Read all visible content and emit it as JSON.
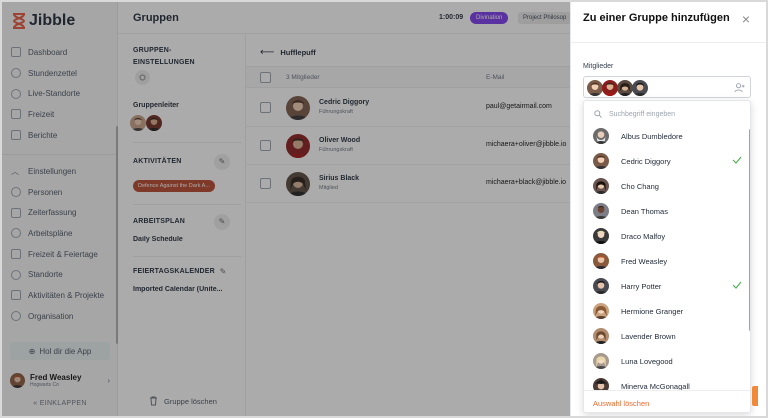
{
  "app": {
    "name": "Jibble"
  },
  "sidebar": {
    "items": [
      {
        "label": "Dashboard",
        "icon": "dashboard-icon"
      },
      {
        "label": "Stundenzettel",
        "icon": "clock-icon"
      },
      {
        "label": "Live-Standorte",
        "icon": "location-icon"
      },
      {
        "label": "Freizeit",
        "icon": "calendar-icon"
      },
      {
        "label": "Berichte",
        "icon": "report-icon"
      }
    ],
    "settings_items": [
      {
        "label": "Einstellungen",
        "icon": "chevron-up-icon"
      },
      {
        "label": "Personen",
        "icon": "people-icon"
      },
      {
        "label": "Zeiterfassung",
        "icon": "timer-icon"
      },
      {
        "label": "Arbeitspläne",
        "icon": "schedule-icon"
      },
      {
        "label": "Freizeit & Feiertage",
        "icon": "holiday-icon"
      },
      {
        "label": "Standorte",
        "icon": "location-icon"
      },
      {
        "label": "Aktivitäten & Projekte",
        "icon": "tag-icon"
      },
      {
        "label": "Organisation",
        "icon": "gear-icon"
      }
    ],
    "app_button": "Hol dir die App",
    "user": {
      "name": "Fred Weasley",
      "org": "Hogwarts Co"
    },
    "collapse_label": "EINKLAPPEN"
  },
  "header": {
    "title": "Gruppen",
    "timer": "1:00:09",
    "activity_badge": "Divination",
    "project_badge": "Project Philosop"
  },
  "group_settings": {
    "title": "GRUPPEN-EINSTELLUNGEN",
    "leader_label": "Gruppenleiter",
    "activities_label": "AKTIVITÄTEN",
    "activity_tag": "Defence Against the Dark A...",
    "schedule_label": "ARBEITSPLAN",
    "schedule_value": "Daily Schedule",
    "calendar_label": "FEIERTAGSKALENDER",
    "calendar_value": "Imported Calendar (Unite...",
    "delete_label": "Gruppe löschen"
  },
  "members_table": {
    "back_label": "Hufflepuff",
    "columns": [
      "3 Mitglieder",
      "E-Mail"
    ],
    "rows": [
      {
        "name": "Cedric Diggory",
        "role": "Führungskraft",
        "email": "paul@getairmail.com"
      },
      {
        "name": "Oliver Wood",
        "role": "Führungskraft",
        "email": "michaera+oliver@jibble.io"
      },
      {
        "name": "Sirius Black",
        "role": "Mitglied",
        "email": "michaera+black@jibble.io"
      }
    ]
  },
  "panel": {
    "title": "Zu einer Gruppe hinzufügen",
    "members_label": "Mitglieder",
    "search_placeholder": "Suchbegriff eingeben",
    "clear_label": "Auswahl löschen",
    "options": [
      {
        "name": "Albus Dumbledore",
        "selected": false
      },
      {
        "name": "Cedric Diggory",
        "selected": true
      },
      {
        "name": "Cho Chang",
        "selected": false
      },
      {
        "name": "Dean Thomas",
        "selected": false
      },
      {
        "name": "Draco Malfoy",
        "selected": false
      },
      {
        "name": "Fred Weasley",
        "selected": false
      },
      {
        "name": "Harry Potter",
        "selected": true
      },
      {
        "name": "Hermione Granger",
        "selected": false
      },
      {
        "name": "Lavender Brown",
        "selected": false
      },
      {
        "name": "Luna Lovegood",
        "selected": false
      },
      {
        "name": "Minerva McGonagall",
        "selected": false
      }
    ]
  },
  "colors": {
    "accent": "#7c3aed",
    "tag": "#b9472d",
    "orange": "#ea6c2e",
    "check": "#4caf50"
  }
}
